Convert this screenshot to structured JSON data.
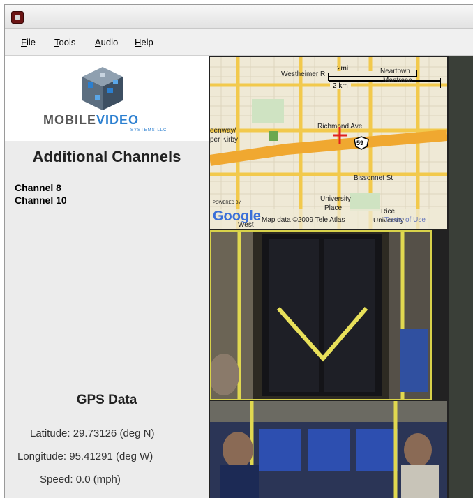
{
  "menu": {
    "file": "File",
    "tools": "Tools",
    "audio": "Audio",
    "help": "Help"
  },
  "logo": {
    "word_main": "MOBILE",
    "word_accent": "VIDEO",
    "tagline": "SYSTEMS LLC"
  },
  "channels": {
    "title": "Additional Channels",
    "items": [
      "Channel 8",
      "Channel 10"
    ]
  },
  "gps": {
    "title": "GPS Data",
    "latitude": "Latitude: 29.73126 (deg N)",
    "longitude": "Longitude: 95.41291 (deg W)",
    "speed": "Speed: 0.0 (mph)"
  },
  "map": {
    "scale_mi": "2mi",
    "scale_km": "2 km",
    "streets": [
      "Westheimer R",
      "Neartown",
      "Montrose",
      "Richmond Ave",
      "eenway/",
      "per Kirby",
      "Bissonnet St",
      "University",
      "Place",
      "Rice",
      "University",
      "West"
    ],
    "highway": "59",
    "powered_by": "POWERED BY",
    "google": "Google",
    "copyright": "Map data ©2009 Tele Atlas",
    "terms": "Terms of Use"
  },
  "colors": {
    "road": "#f2c94c",
    "highway": "#f0a830",
    "marker": "#e02020",
    "camera_border": "#d8d24a",
    "logo_blue": "#2b7fd0"
  }
}
